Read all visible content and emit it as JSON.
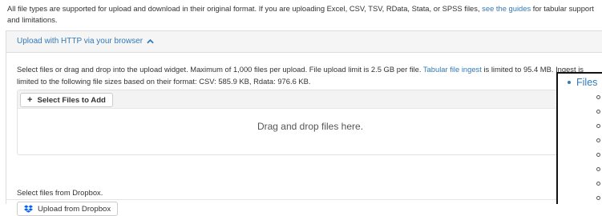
{
  "intro": {
    "text": "All file types are supported for upload and download in their original format. If you are uploading Excel, CSV, TSV, RData, Stata, or SPSS files, ",
    "link": "see the guides",
    "text_after": " for tabular support and limitations."
  },
  "panel": {
    "heading": "Upload with HTTP via your browser",
    "description_before": "Select files or drag and drop into the upload widget. Maximum of 1,000 files per upload. File upload limit is 2.5 GB per file. ",
    "description_link": "Tabular file ingest",
    "description_after": " is limited to 95.4 MB. Ingest is limited to the following file sizes based on their format: CSV: 585.9 KB, Rdata: 976.6 KB.",
    "select_button": "Select Files to Add",
    "drop_text": "Drag and drop files here.",
    "dropbox_label": "Select files from Dropbox.",
    "dropbox_button": "Upload from Dropbox"
  },
  "toc": {
    "heading": "Files",
    "sub_item_count": 8
  },
  "colors": {
    "link": "#337ab7",
    "heading_bg": "#f5f5f5",
    "dropbox_blue": "#0061ff"
  }
}
